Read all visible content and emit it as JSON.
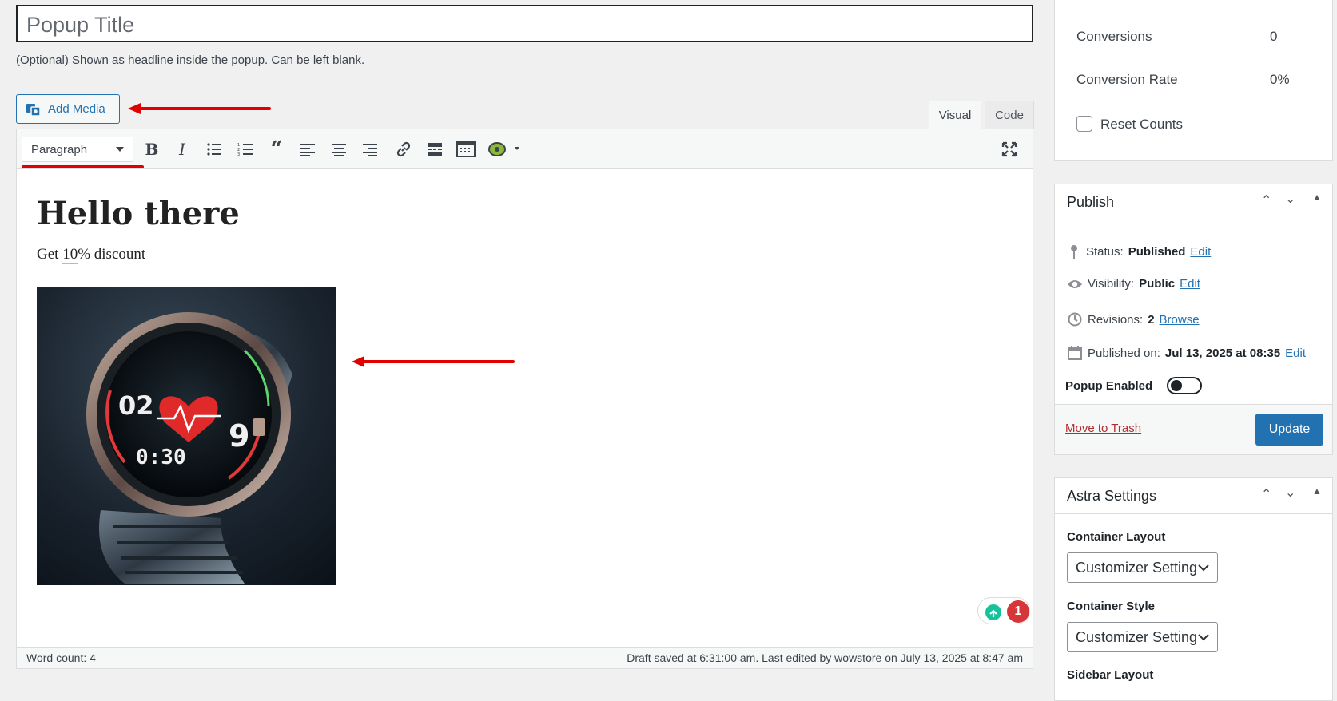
{
  "title_field": {
    "placeholder": "Popup Title",
    "hint": "(Optional) Shown as headline inside the popup. Can be left blank."
  },
  "media": {
    "add_media_label": "Add Media"
  },
  "tabs": {
    "visual": "Visual",
    "code": "Code"
  },
  "toolbar": {
    "format_value": "Paragraph",
    "icons": [
      "bold-icon",
      "italic-icon",
      "bullet-list-icon",
      "numbered-list-icon",
      "blockquote-icon",
      "align-left-icon",
      "align-center-icon",
      "align-right-icon",
      "link-icon",
      "read-more-icon",
      "toolbar-toggle-icon",
      "plugin-icon",
      "fullscreen-icon"
    ]
  },
  "content": {
    "heading": "Hello there",
    "para_before": "Get ",
    "para_spell": "10",
    "para_after": "% discount",
    "image_watch_text": {
      "top_number": "02",
      "right_number": "9",
      "time": "0:30"
    }
  },
  "grammar_badge": {
    "count": "1"
  },
  "statusbar": {
    "word_count": "Word count: 4",
    "saved": "Draft saved at 6:31:00 am. Last edited by wowstore on July 13, 2025 at 8:47 am"
  },
  "stats": {
    "rows": [
      {
        "label": "Conversions",
        "value": "0"
      },
      {
        "label": "Conversion Rate",
        "value": "0%"
      }
    ],
    "reset_label": "Reset Counts"
  },
  "publish": {
    "title": "Publish",
    "status_label": "Status:",
    "status_value": "Published",
    "status_edit": "Edit",
    "visibility_label": "Visibility:",
    "visibility_value": "Public",
    "visibility_edit": "Edit",
    "revisions_label": "Revisions:",
    "revisions_value": "2",
    "revisions_link": "Browse",
    "published_label": "Published on:",
    "published_value": "Jul 13, 2025 at 08:35",
    "published_edit": "Edit",
    "popup_enabled_label": "Popup Enabled",
    "trash_label": "Move to Trash",
    "update_label": "Update"
  },
  "astra": {
    "title": "Astra Settings",
    "container_layout_label": "Container Layout",
    "container_layout_value": "Customizer Setting",
    "container_style_label": "Container Style",
    "container_style_value": "Customizer Setting",
    "sidebar_layout_label": "Sidebar Layout"
  },
  "colors": {
    "accent": "#2271b1",
    "annotation": "#e00000",
    "badge": "#d63638"
  }
}
